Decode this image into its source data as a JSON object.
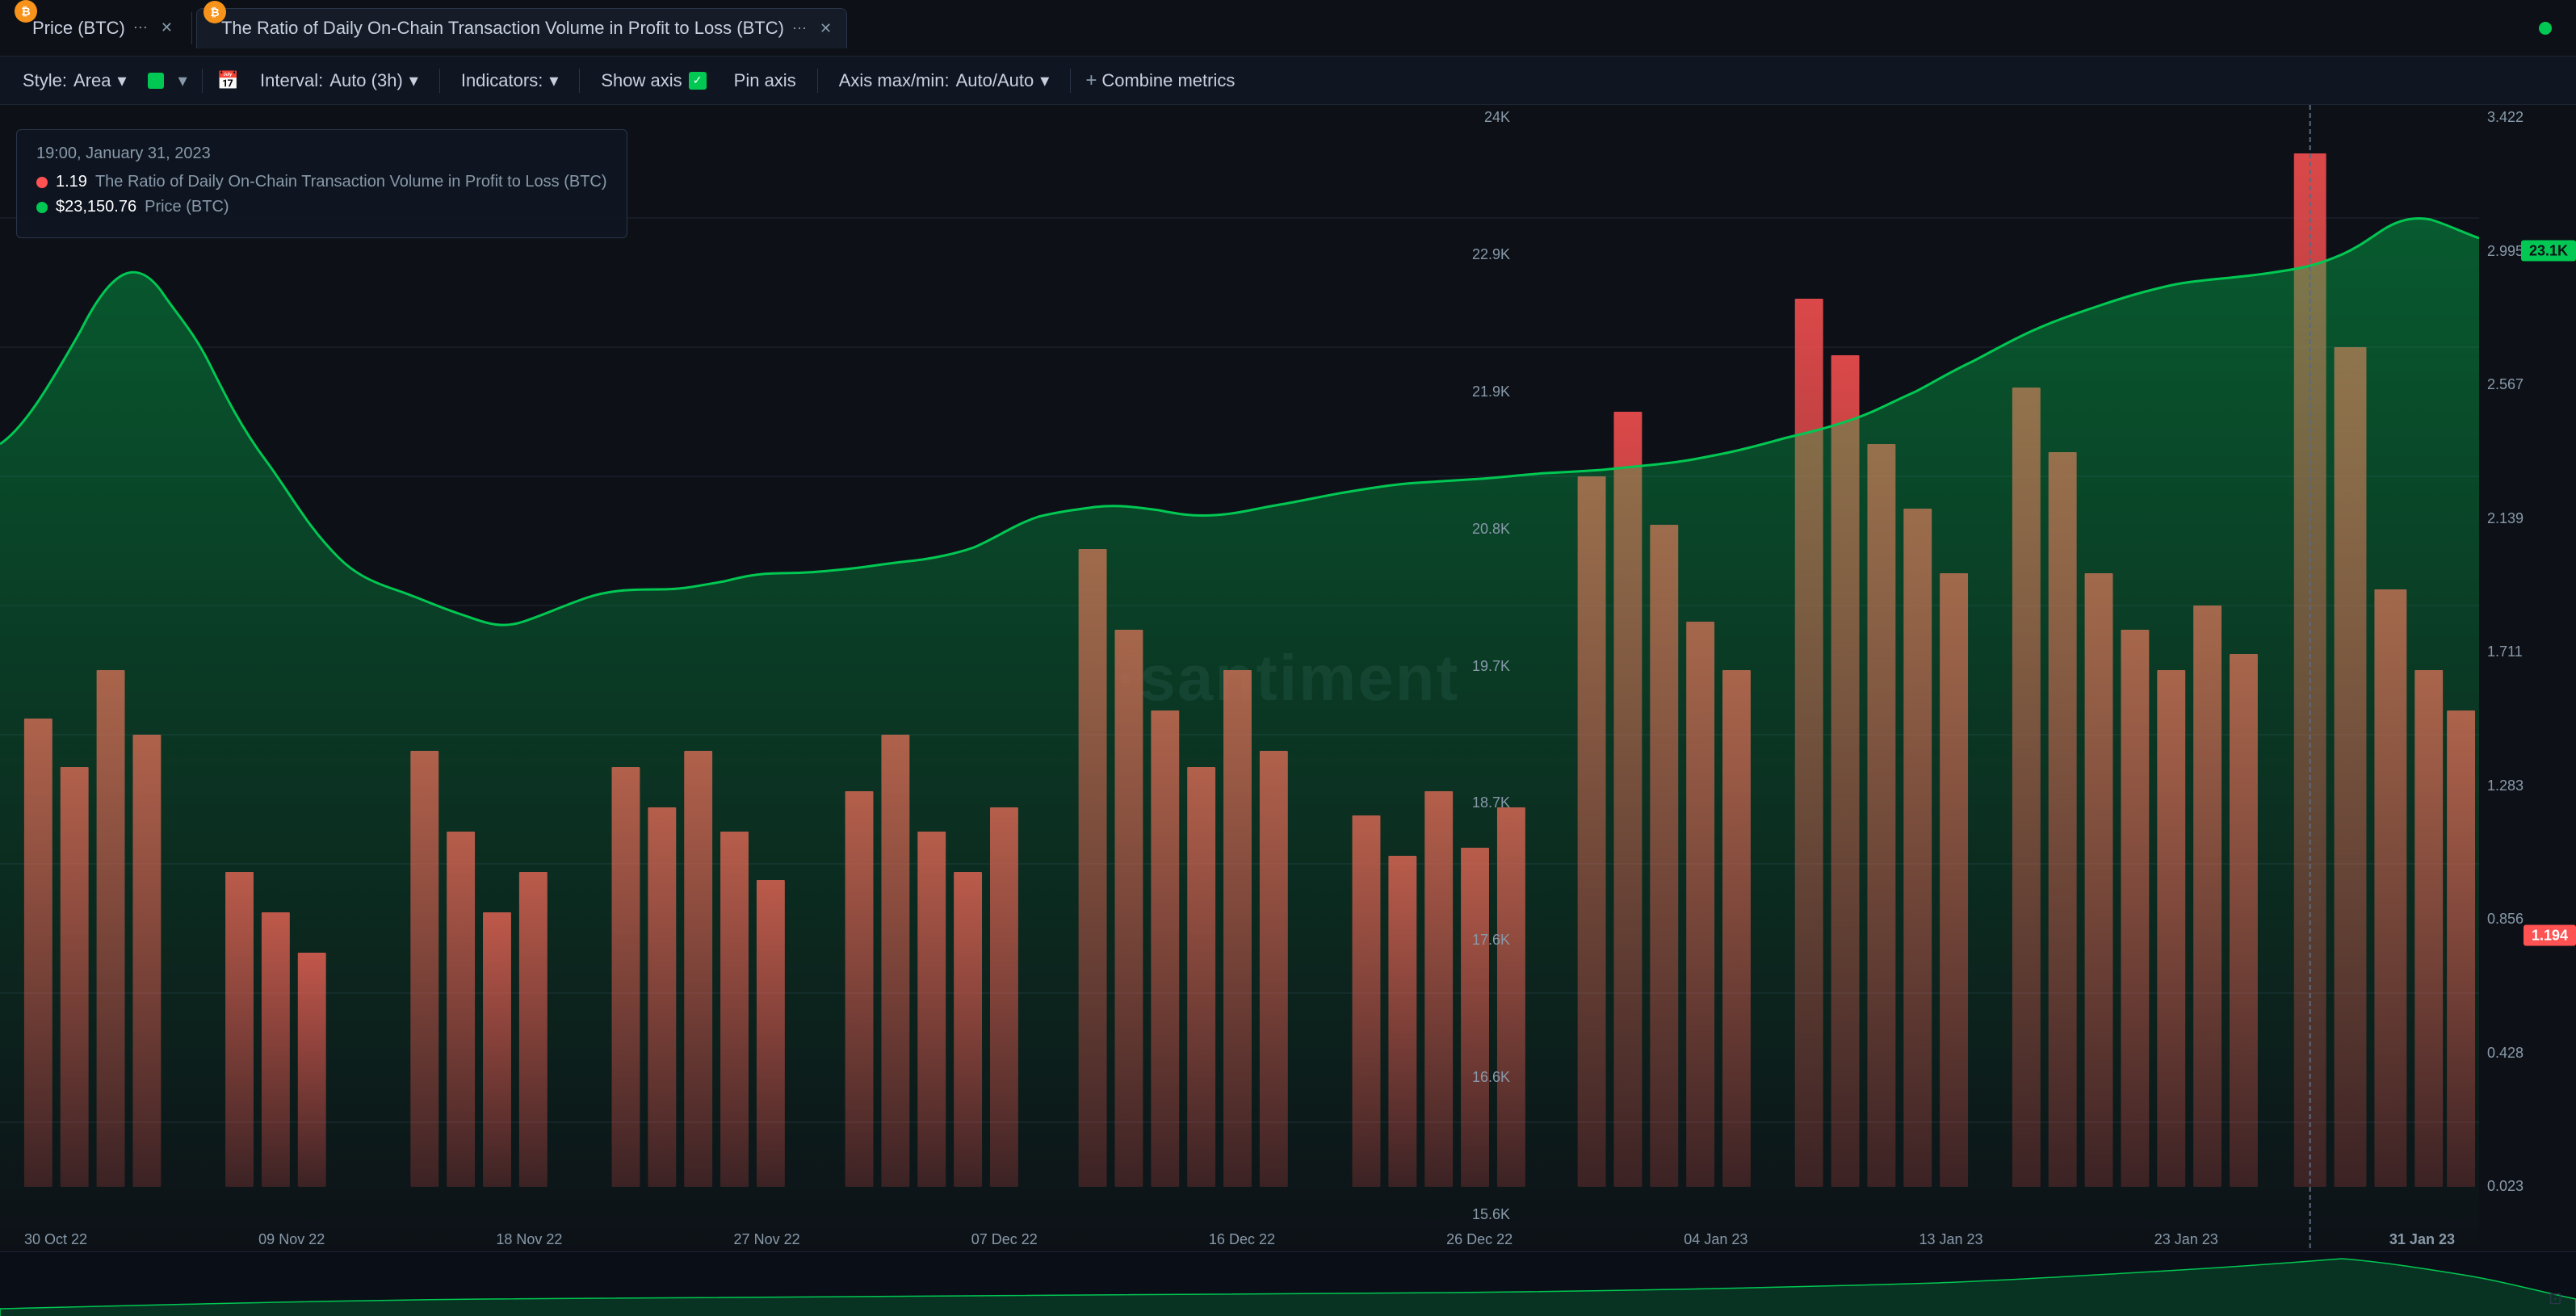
{
  "tabs": [
    {
      "id": "tab1",
      "label": "Price (BTC)",
      "badge": "₿",
      "active": false,
      "has_dots": true,
      "has_close": true
    },
    {
      "id": "tab2",
      "label": "The Ratio of Daily On-Chain Transaction Volume in Profit to Loss (BTC)",
      "badge": "₿",
      "active": true,
      "has_dots": true,
      "has_close": true
    }
  ],
  "online_indicator": "●",
  "toolbar": {
    "style_label": "Style:",
    "style_value": "Area",
    "interval_label": "Interval:",
    "interval_value": "Auto (3h)",
    "indicators_label": "Indicators:",
    "show_axis_label": "Show axis",
    "pin_axis_label": "Pin axis",
    "axis_maxmin_label": "Axis max/min:",
    "axis_maxmin_value": "Auto/Auto",
    "combine_metrics_label": "Combine metrics"
  },
  "tooltip": {
    "date": "19:00, January 31, 2023",
    "rows": [
      {
        "color": "red",
        "value": "1.19",
        "metric": "The Ratio of Daily On-Chain Transaction Volume in Profit to Loss (BTC)"
      },
      {
        "color": "green",
        "value": "$23,150.76",
        "metric": "Price (BTC)"
      }
    ]
  },
  "watermark": "·santiment",
  "y_axis_left": {
    "labels": [
      "24K",
      "22.9K",
      "21.9K",
      "20.8K",
      "19.7K",
      "18.7K",
      "17.6K",
      "16.6K",
      "15.6K"
    ]
  },
  "y_axis_right": {
    "labels": [
      "3.422",
      "2.995",
      "2.567",
      "2.139",
      "1.711",
      "1.283",
      "0.856",
      "0.428",
      "0.023"
    ]
  },
  "x_axis": {
    "labels": [
      "30 Oct 22",
      "09 Nov 22",
      "18 Nov 22",
      "27 Nov 22",
      "07 Dec 22",
      "16 Dec 22",
      "26 Dec 22",
      "04 Jan 23",
      "13 Jan 23",
      "23 Jan 23",
      "31 Jan 23"
    ]
  },
  "current_values": {
    "price": "23.1K",
    "ratio": "1.194"
  },
  "chart": {
    "bars": [
      {
        "x": 2,
        "h": 55,
        "peak": false
      },
      {
        "x": 3.5,
        "h": 40,
        "peak": false
      },
      {
        "x": 5,
        "h": 70,
        "peak": false
      },
      {
        "x": 6.5,
        "h": 30,
        "peak": false
      },
      {
        "x": 8,
        "h": 45,
        "peak": false
      },
      {
        "x": 9.5,
        "h": 20,
        "peak": false
      },
      {
        "x": 11,
        "h": 50,
        "peak": false
      },
      {
        "x": 12.5,
        "h": 35,
        "peak": false
      }
    ]
  }
}
